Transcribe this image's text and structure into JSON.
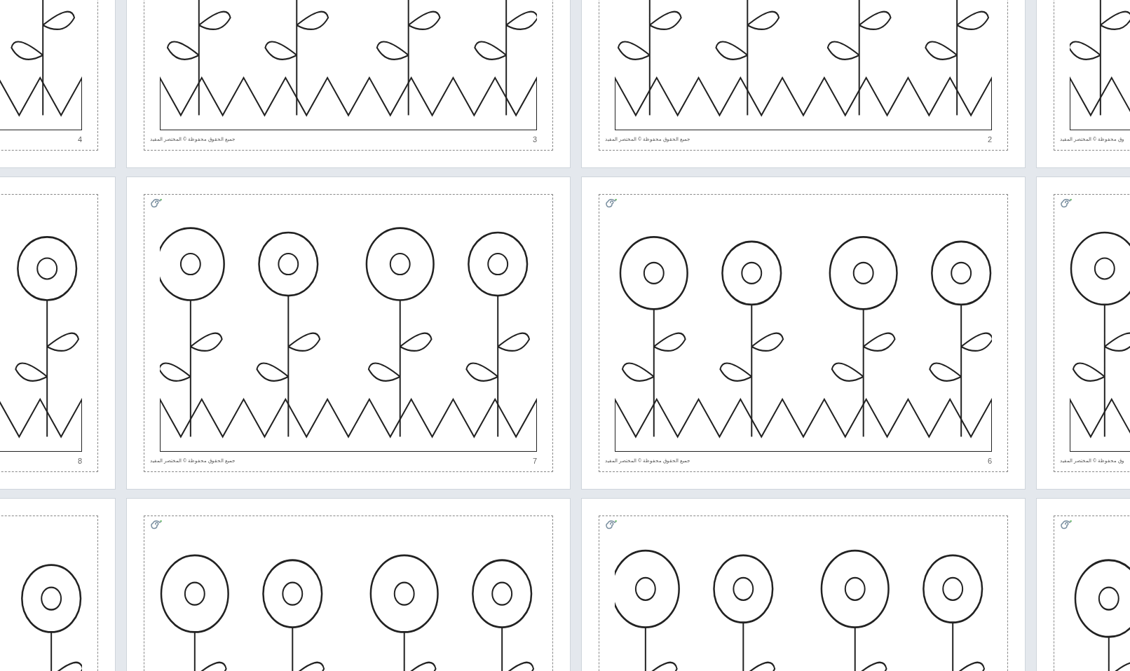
{
  "pages": [
    {
      "kind": "picture",
      "footer": "وق محفوظة © المختصر المفيد"
    },
    {
      "kind": "picture",
      "number": "2",
      "footer": "جميع الحقوق محفوظة © المختصر المفيد"
    },
    {
      "kind": "picture",
      "number": "3",
      "footer": "جميع الحقوق محفوظة © المختصر المفيد"
    },
    {
      "kind": "picture",
      "number": "4"
    },
    {
      "kind": "picture",
      "footer": "وق محفوظة © المختصر المفيد"
    },
    {
      "kind": "picture",
      "number": "6",
      "footer": "جميع الحقوق محفوظة © المختصر المفيد"
    },
    {
      "kind": "picture",
      "number": "7",
      "footer": "جميع الحقوق محفوظة © المختصر المفيد"
    },
    {
      "kind": "picture",
      "number": "8"
    },
    {
      "kind": "picture"
    },
    {
      "kind": "picture"
    },
    {
      "kind": "picture"
    },
    {
      "kind": "picture"
    }
  ]
}
